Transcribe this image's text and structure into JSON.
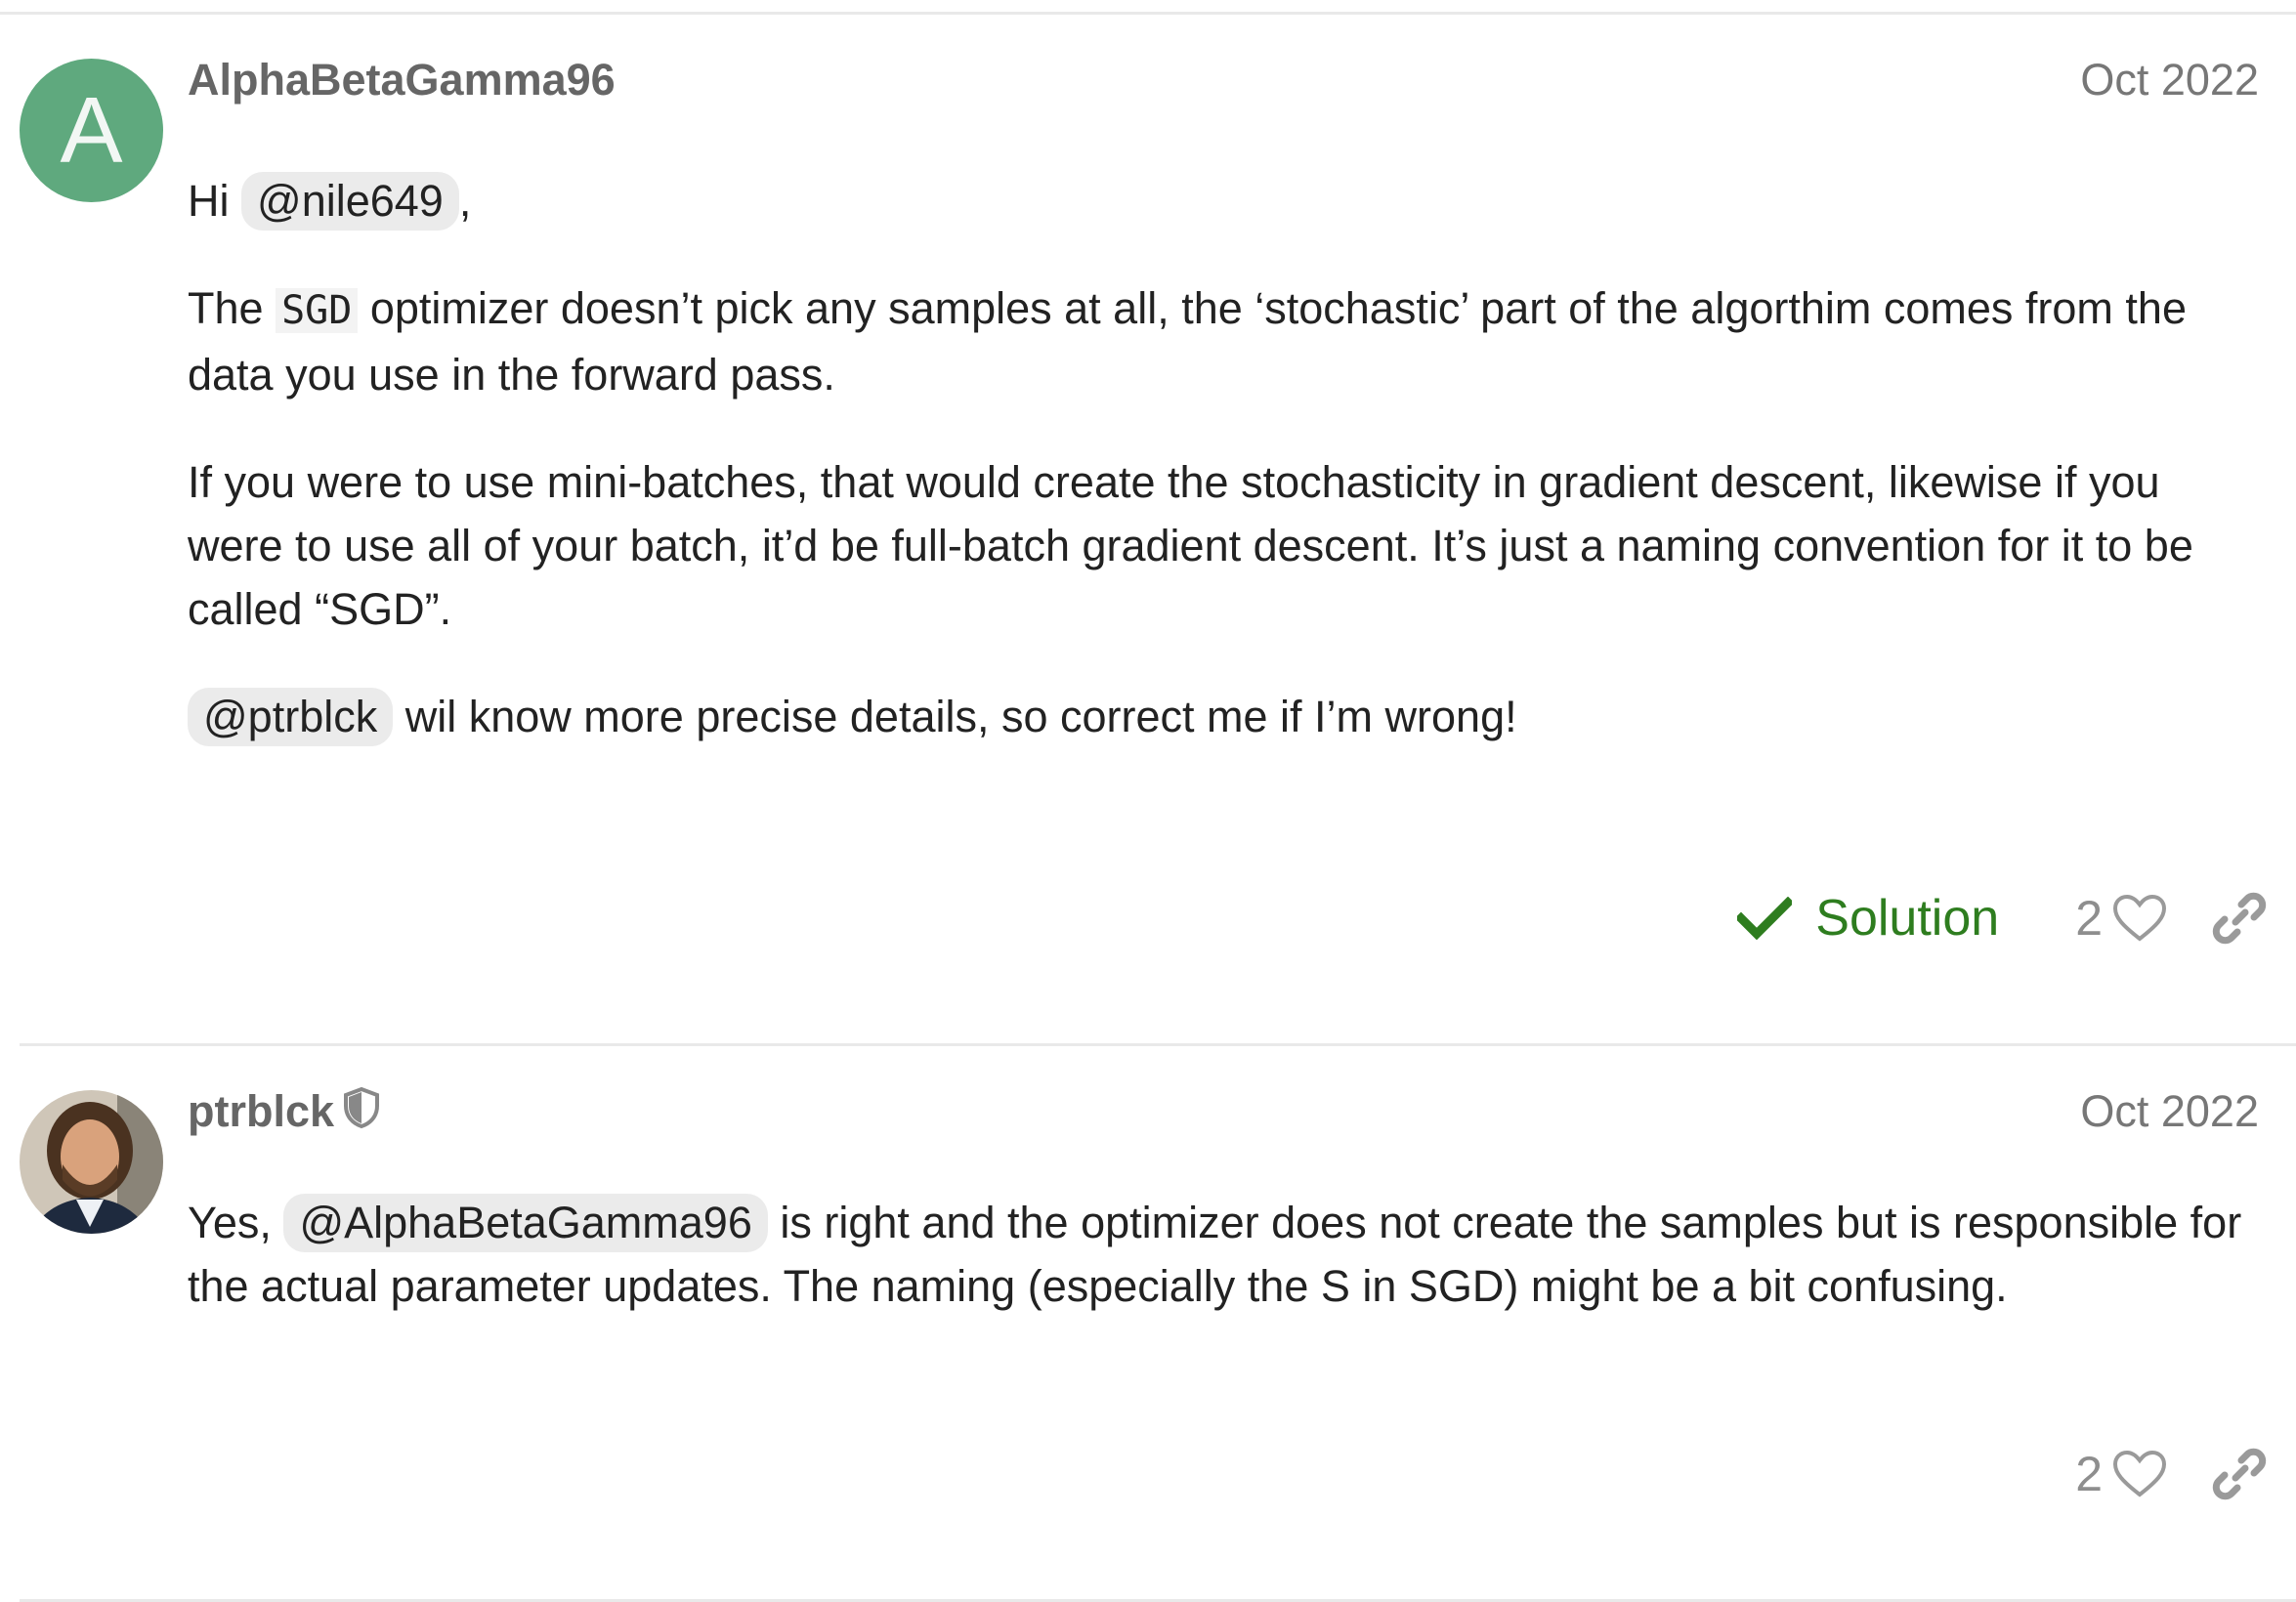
{
  "posts": [
    {
      "username": "AlphaBetaGamma96",
      "avatar_letter": "A",
      "date": "Oct 2022",
      "p1_hi": "Hi",
      "p1_mention": "@nile649",
      "p1_comma": ",",
      "p2_a": "The",
      "p2_code": "SGD",
      "p2_b": "optimizer doesn’t pick any samples at all, the ‘stochastic’ part of the algorthim comes from the data you use in the forward pass.",
      "p3": "If you were to use mini-batches, that would create the stochasticity in gradient descent, likewise if you were to use all of your batch, it’d be full-batch gradient descent. It’s just a naming convention for it to be called “SGD”.",
      "p4_mention": "@ptrblck",
      "p4_text": "wil know more precise details, so correct me if I’m wrong!",
      "solution_label": "Solution",
      "like_count": "2"
    },
    {
      "username": "ptrblck",
      "date": "Oct 2022",
      "p1_a": "Yes,",
      "p1_mention": "@AlphaBetaGamma96",
      "p1_b": "is right and the optimizer does not create the samples but is responsible for the actual parameter updates. The naming (especially the S in SGD) might be a bit confusing.",
      "like_count": "2"
    }
  ],
  "colors": {
    "avatar_green": "#5fa97e",
    "solution_green": "#2e7d1f",
    "muted_gray": "#8e8e8e"
  },
  "icons": [
    "checkmark-icon",
    "heart-icon",
    "link-icon",
    "shield-icon"
  ]
}
